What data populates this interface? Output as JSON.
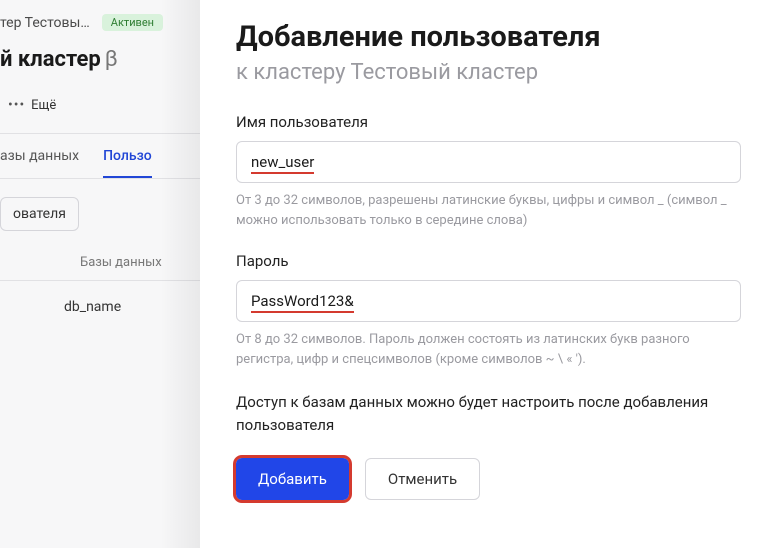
{
  "background": {
    "breadcrumb_text": "тер Тестовы…",
    "status_label": "Активен",
    "title_fragment": "й кластер",
    "beta_label": "β",
    "more_label": "Ещё",
    "tabs": {
      "databases": "азы данных",
      "users": "Пользо"
    },
    "subaction_label": "ователя",
    "col_header": "Базы данных",
    "db_cell": "db_name"
  },
  "panel": {
    "title": "Добавление пользователя",
    "subtitle": "к кластеру Тестовый кластер",
    "username": {
      "label": "Имя пользователя",
      "value": "new_user",
      "hint": "От 3 до 32 символов, разрешены латинские буквы, цифры и символ _ (символ _ можно использовать только в середине слова)"
    },
    "password": {
      "label": "Пароль",
      "value": "PassWord123&",
      "hint": "От 8 до 32 символов. Пароль должен состоять из латинских букв разного регистра, цифр и спецсимволов (кроме символов ~ \\ « ')."
    },
    "access_note": "Доступ к базам данных можно будет настроить после добавления пользователя",
    "buttons": {
      "add": "Добавить",
      "cancel": "Отменить"
    }
  }
}
